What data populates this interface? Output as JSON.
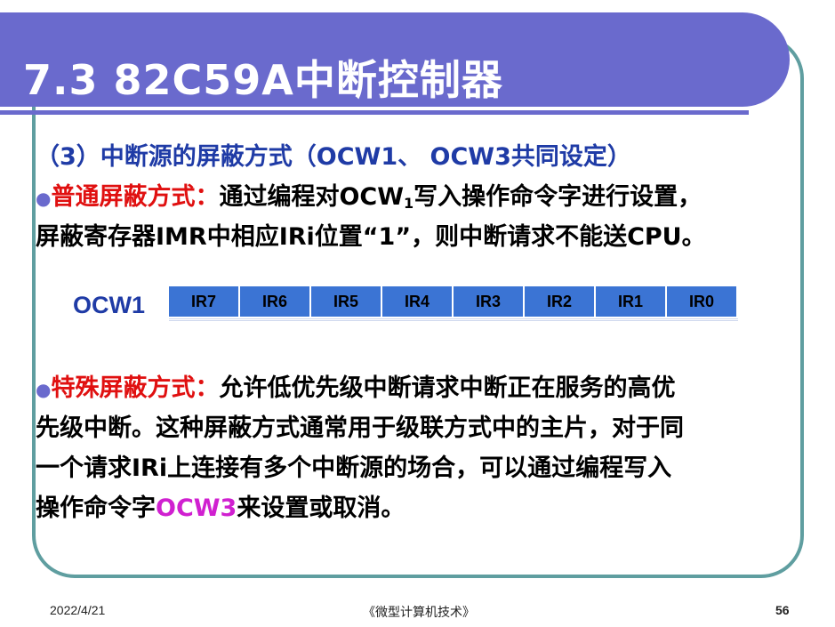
{
  "title": "7.3  82C59A中断控制器",
  "section_heading": "（3）中断源的屏蔽方式（OCW1、  OCW3共同设定）",
  "bullet1": {
    "term": "普通屏蔽方式：",
    "text_a": "通过编程对OCW",
    "subscript": "1",
    "text_b": "写入操作命令字进行设置，",
    "line2": "屏蔽寄存器IMR中相应IRi位置“1”，则中断请求不能送CPU。"
  },
  "register": {
    "label": "OCW1",
    "bits": [
      "IR7",
      "IR6",
      "IR5",
      "IR4",
      "IR3",
      "IR2",
      "IR1",
      "IR0"
    ]
  },
  "bullet2": {
    "term": "特殊屏蔽方式：",
    "line1": "允许低优先级中断请求中断正在服务的高优",
    "line2": "先级中断。这种屏蔽方式通常用于级联方式中的主片，对于同",
    "line3": "一个请求IRi上连接有多个中断源的场合，可以通过编程写入",
    "line4_a": "操作命令字",
    "line4_highlight": "OCW3",
    "line4_b": "来设置或取消。"
  },
  "footer": {
    "date": "2022/4/21",
    "course": "《微型计算机技术》",
    "page": "56"
  }
}
